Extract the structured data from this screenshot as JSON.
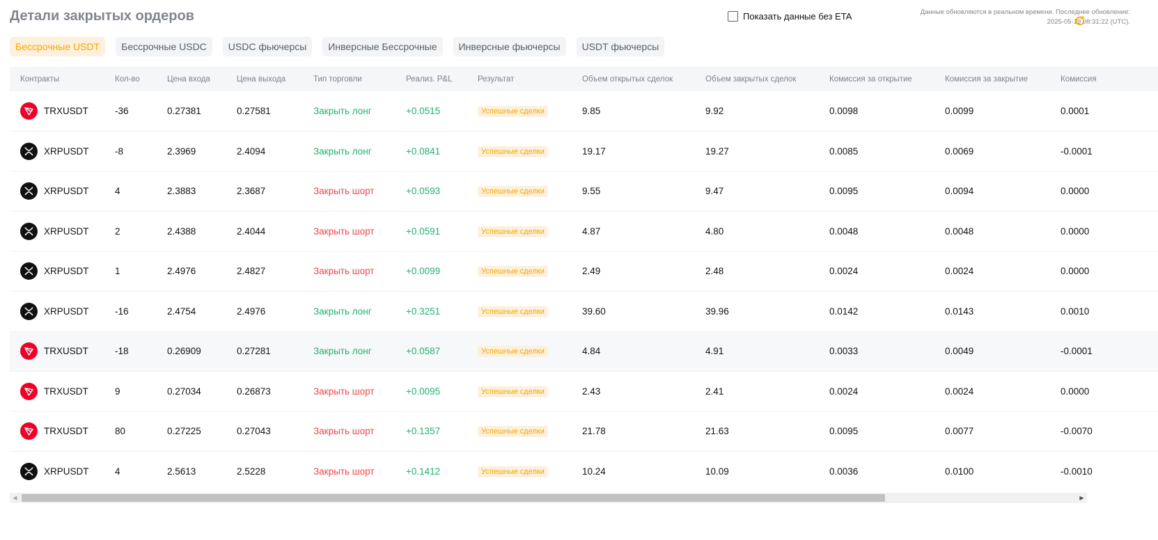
{
  "page": {
    "title": "Детали закрытых ордеров",
    "eta_toggle_label": "Показать данные без ETA",
    "update_line1": "Данные обновляются в реальном времени. Последнее обновление:",
    "update_line2": "2025-05-19 08:31:22 (UTC)."
  },
  "colors": {
    "accent": "#f7a600",
    "profit": "#20b26c",
    "loss": "#ef454a",
    "trx": "#ef0027",
    "xrp": "#101010"
  },
  "tabs": [
    {
      "label": "Бессрочные USDT",
      "active": true
    },
    {
      "label": "Бессрочные USDC",
      "active": false
    },
    {
      "label": "USDC фьючерсы",
      "active": false
    },
    {
      "label": "Инверсные Бессрочные",
      "active": false
    },
    {
      "label": "Инверсные фьючерсы",
      "active": false
    },
    {
      "label": "USDT фьючерсы",
      "active": false
    }
  ],
  "table": {
    "columns": [
      "Контракты",
      "Кол-во",
      "Цена входа",
      "Цена выхода",
      "Тип торговли",
      "Реализ. P&L",
      "Результат",
      "Объем открытых сделок",
      "Объем закрытых сделок",
      "Комиссия за открытие",
      "Комиссия за закрытие",
      "Комиссия"
    ],
    "rows": [
      {
        "coin": "trx",
        "contract": "TRXUSDT",
        "qty": "-36",
        "entry": "0.27381",
        "exit": "0.27581",
        "type": "Закрыть лонг",
        "side": "long",
        "pnl": "+0.0515",
        "result": "Успешные сделки",
        "open_vol": "9.85",
        "close_vol": "9.92",
        "open_fee": "0.0098",
        "close_fee": "0.0099",
        "fee": "0.0001"
      },
      {
        "coin": "xrp",
        "contract": "XRPUSDT",
        "qty": "-8",
        "entry": "2.3969",
        "exit": "2.4094",
        "type": "Закрыть лонг",
        "side": "long",
        "pnl": "+0.0841",
        "result": "Успешные сделки",
        "open_vol": "19.17",
        "close_vol": "19.27",
        "open_fee": "0.0085",
        "close_fee": "0.0069",
        "fee": "-0.0001"
      },
      {
        "coin": "xrp",
        "contract": "XRPUSDT",
        "qty": "4",
        "entry": "2.3883",
        "exit": "2.3687",
        "type": "Закрыть шорт",
        "side": "short",
        "pnl": "+0.0593",
        "result": "Успешные сделки",
        "open_vol": "9.55",
        "close_vol": "9.47",
        "open_fee": "0.0095",
        "close_fee": "0.0094",
        "fee": "0.0000"
      },
      {
        "coin": "xrp",
        "contract": "XRPUSDT",
        "qty": "2",
        "entry": "2.4388",
        "exit": "2.4044",
        "type": "Закрыть шорт",
        "side": "short",
        "pnl": "+0.0591",
        "result": "Успешные сделки",
        "open_vol": "4.87",
        "close_vol": "4.80",
        "open_fee": "0.0048",
        "close_fee": "0.0048",
        "fee": "0.0000"
      },
      {
        "coin": "xrp",
        "contract": "XRPUSDT",
        "qty": "1",
        "entry": "2.4976",
        "exit": "2.4827",
        "type": "Закрыть шорт",
        "side": "short",
        "pnl": "+0.0099",
        "result": "Успешные сделки",
        "open_vol": "2.49",
        "close_vol": "2.48",
        "open_fee": "0.0024",
        "close_fee": "0.0024",
        "fee": "0.0000"
      },
      {
        "coin": "xrp",
        "contract": "XRPUSDT",
        "qty": "-16",
        "entry": "2.4754",
        "exit": "2.4976",
        "type": "Закрыть лонг",
        "side": "long",
        "pnl": "+0.3251",
        "result": "Успешные сделки",
        "open_vol": "39.60",
        "close_vol": "39.96",
        "open_fee": "0.0142",
        "close_fee": "0.0143",
        "fee": "0.0010"
      },
      {
        "coin": "trx",
        "contract": "TRXUSDT",
        "qty": "-18",
        "entry": "0.26909",
        "exit": "0.27281",
        "type": "Закрыть лонг",
        "side": "long",
        "pnl": "+0.0587",
        "result": "Успешные сделки",
        "open_vol": "4.84",
        "close_vol": "4.91",
        "open_fee": "0.0033",
        "close_fee": "0.0049",
        "fee": "-0.0001"
      },
      {
        "coin": "trx",
        "contract": "TRXUSDT",
        "qty": "9",
        "entry": "0.27034",
        "exit": "0.26873",
        "type": "Закрыть шорт",
        "side": "short",
        "pnl": "+0.0095",
        "result": "Успешные сделки",
        "open_vol": "2.43",
        "close_vol": "2.41",
        "open_fee": "0.0024",
        "close_fee": "0.0024",
        "fee": "0.0000"
      },
      {
        "coin": "trx",
        "contract": "TRXUSDT",
        "qty": "80",
        "entry": "0.27225",
        "exit": "0.27043",
        "type": "Закрыть шорт",
        "side": "short",
        "pnl": "+0.1357",
        "result": "Успешные сделки",
        "open_vol": "21.78",
        "close_vol": "21.63",
        "open_fee": "0.0095",
        "close_fee": "0.0077",
        "fee": "-0.0070"
      },
      {
        "coin": "xrp",
        "contract": "XRPUSDT",
        "qty": "4",
        "entry": "2.5613",
        "exit": "2.5228",
        "type": "Закрыть шорт",
        "side": "short",
        "pnl": "+0.1412",
        "result": "Успешные сделки",
        "open_vol": "10.24",
        "close_vol": "10.09",
        "open_fee": "0.0036",
        "close_fee": "0.0100",
        "fee": "-0.0010"
      }
    ]
  },
  "icons": {
    "refresh": "refresh-icon",
    "trx": "trx-coin-icon",
    "xrp": "xrp-coin-icon",
    "scroll_left": "scroll-left-icon",
    "scroll_right": "scroll-right-icon"
  }
}
